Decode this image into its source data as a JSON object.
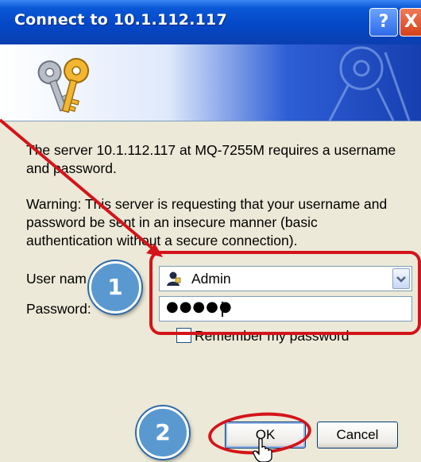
{
  "dialog": {
    "title": "Connect to 10.1.112.117",
    "message": "The server 10.1.112.117 at MQ-7255M requires a username and password.",
    "warning": "Warning: This server is requesting that your username and password be sent in an insecure manner (basic authentication without a secure connection)."
  },
  "titlebar": {
    "help_label": "?",
    "close_label": "X"
  },
  "form": {
    "user_label": "User nam",
    "user_value": "Admin",
    "password_label": "Password:",
    "password_value": "●●●●●",
    "remember_label": "Remember my password",
    "remember_checked": false
  },
  "buttons": {
    "ok_label": "OK",
    "cancel_label": "Cancel"
  },
  "annotations": {
    "step1": "1",
    "step2": "2",
    "color": "#d4141a",
    "badge_color": "#5a99d0"
  },
  "icons": [
    "keys-icon",
    "user-icon",
    "dropdown-arrow-icon",
    "hand-cursor-icon",
    "annotation-arrow"
  ]
}
